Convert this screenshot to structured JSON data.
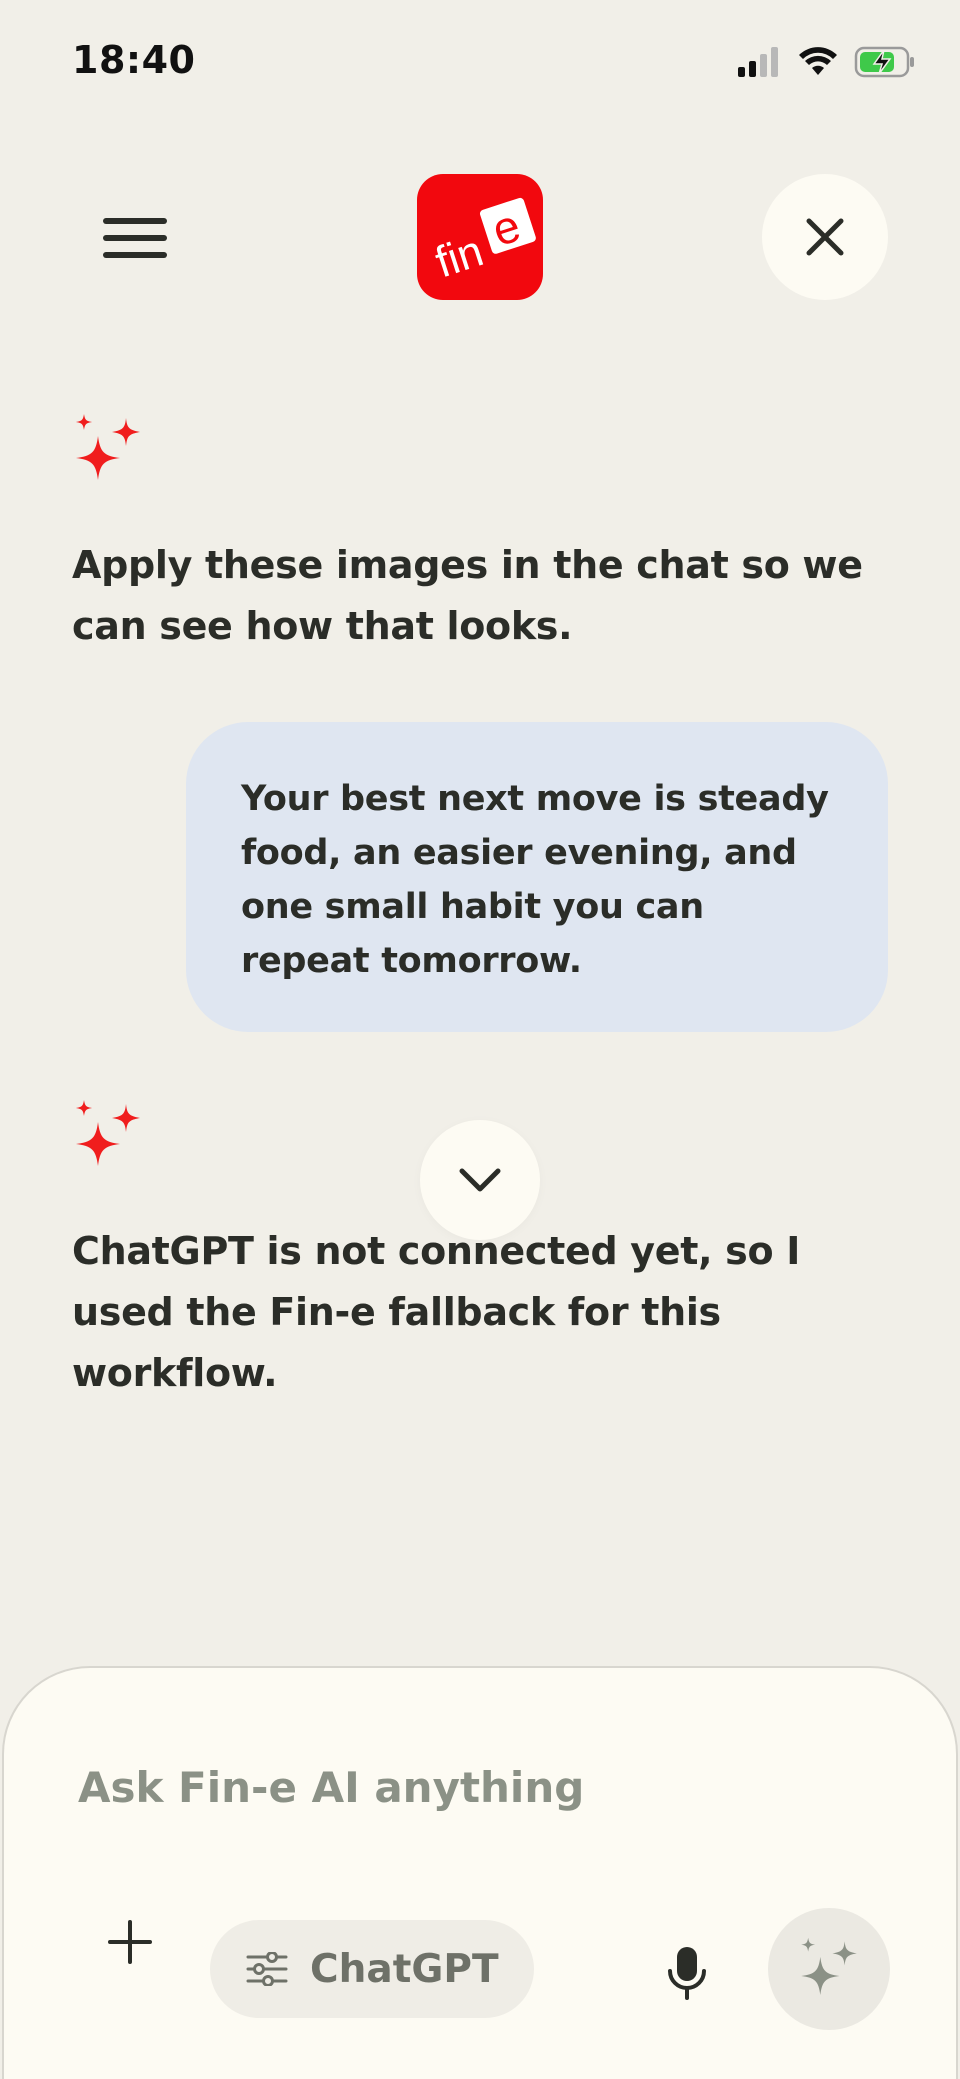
{
  "status_bar": {
    "time": "18:40"
  },
  "header": {
    "logo_text_fin": "fin",
    "logo_text_e": "e"
  },
  "messages": [
    {
      "role": "assistant",
      "text": "Apply these images in the chat so we can see how that looks."
    },
    {
      "role": "user",
      "text": "Your best next move is steady food, an easier evening, and one small habit you can repeat tomorrow."
    },
    {
      "role": "assistant",
      "text": "ChatGPT is not connected yet, so I used the Fin-e fallback for this workflow."
    }
  ],
  "composer": {
    "placeholder": "Ask Fin-e AI anything",
    "model_label": "ChatGPT"
  },
  "colors": {
    "background": "#f1efe8",
    "brand_red": "#f2080e",
    "user_bubble": "#dfe6f1",
    "composer_bg": "#fdfbf3",
    "battery_green": "#3fc94a"
  },
  "icons": {
    "menu": "hamburger-icon",
    "close": "close-icon",
    "assistant_avatar": "sparkle-icon",
    "scroll": "chevron-down-icon",
    "add": "plus-icon",
    "model": "sliders-icon",
    "mic": "microphone-icon",
    "send": "sparkle-icon"
  }
}
